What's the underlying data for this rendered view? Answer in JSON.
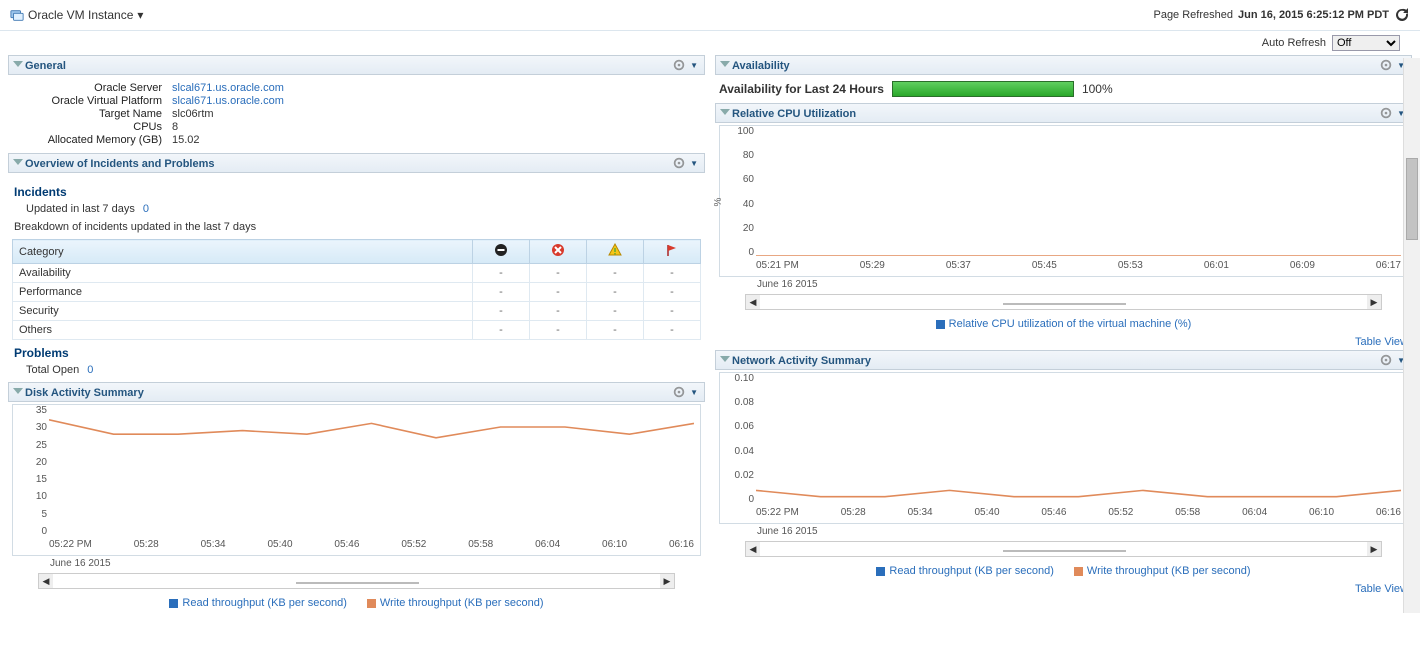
{
  "header": {
    "title": "Oracle VM Instance",
    "refresh_label": "Page Refreshed",
    "refresh_time": "Jun 16, 2015 6:25:12 PM PDT"
  },
  "auto_refresh": {
    "label": "Auto Refresh",
    "selected": "Off",
    "options": [
      "Off"
    ]
  },
  "general": {
    "title": "General",
    "rows": [
      {
        "k": "Oracle Server",
        "v": "slcal671.us.oracle.com",
        "link": true
      },
      {
        "k": "Oracle Virtual Platform",
        "v": "slcal671.us.oracle.com",
        "link": true
      },
      {
        "k": "Target Name",
        "v": "slc06rtm"
      },
      {
        "k": "CPUs",
        "v": "8"
      },
      {
        "k": "Allocated Memory (GB)",
        "v": "15.02"
      }
    ]
  },
  "incidents": {
    "title": "Overview of Incidents and Problems",
    "sub1": "Incidents",
    "updated_lbl": "Updated in last 7 days",
    "updated_val": "0",
    "breakdown_lbl": "Breakdown of incidents updated in the last 7 days",
    "cat_header": "Category",
    "rows": [
      {
        "c": "Availability",
        "v": [
          "-",
          "-",
          "-",
          "-"
        ]
      },
      {
        "c": "Performance",
        "v": [
          "-",
          "-",
          "-",
          "-"
        ]
      },
      {
        "c": "Security",
        "v": [
          "-",
          "-",
          "-",
          "-"
        ]
      },
      {
        "c": "Others",
        "v": [
          "-",
          "-",
          "-",
          "-"
        ]
      }
    ],
    "sub2": "Problems",
    "total_open_lbl": "Total Open",
    "total_open_val": "0"
  },
  "disk": {
    "title": "Disk Activity Summary",
    "date": "June 16 2015",
    "legend": [
      {
        "c": "#2a6ebb",
        "t": "Read throughput (KB per second)"
      },
      {
        "c": "#e08a5a",
        "t": "Write throughput (KB per second)"
      }
    ]
  },
  "availability": {
    "title": "Availability",
    "label": "Availability for Last 24 Hours",
    "pct": "100%"
  },
  "cpu": {
    "title": "Relative CPU Utilization",
    "ylabel": "%",
    "date": "June 16 2015",
    "legend": [
      {
        "c": "#2a6ebb",
        "t": "Relative CPU utilization of the virtual machine (%)"
      }
    ],
    "table_view": "Table View"
  },
  "net": {
    "title": "Network Activity Summary",
    "date": "June 16 2015",
    "legend": [
      {
        "c": "#2a6ebb",
        "t": "Read throughput (KB per second)"
      },
      {
        "c": "#e08a5a",
        "t": "Write throughput (KB per second)"
      }
    ],
    "table_view": "Table View"
  },
  "chart_data": [
    {
      "type": "line",
      "title": "Disk Activity Summary",
      "x": [
        "05:22 PM",
        "05:28",
        "05:34",
        "05:40",
        "05:46",
        "05:52",
        "05:58",
        "06:04",
        "06:10",
        "06:16"
      ],
      "ylim": [
        0,
        35
      ],
      "yticks": [
        0,
        5,
        10,
        15,
        20,
        25,
        30,
        35
      ],
      "series": [
        {
          "name": "Write throughput (KB per second)",
          "values": [
            32,
            28,
            28,
            29,
            28,
            31,
            27,
            30,
            30,
            28,
            31
          ]
        }
      ]
    },
    {
      "type": "line",
      "title": "Relative CPU Utilization",
      "x": [
        "05:21 PM",
        "05:29",
        "05:37",
        "05:45",
        "05:53",
        "06:01",
        "06:09",
        "06:17"
      ],
      "ylim": [
        0,
        100
      ],
      "yticks": [
        0,
        20,
        40,
        60,
        80,
        100
      ],
      "ylabel": "%",
      "series": [
        {
          "name": "Relative CPU utilization of the virtual machine (%)",
          "values": [
            0,
            0,
            0,
            0,
            0,
            0,
            0,
            0
          ]
        }
      ]
    },
    {
      "type": "line",
      "title": "Network Activity Summary",
      "x": [
        "05:22 PM",
        "05:28",
        "05:34",
        "05:40",
        "05:46",
        "05:52",
        "05:58",
        "06:04",
        "06:10",
        "06:16"
      ],
      "ylim": [
        0,
        0.1
      ],
      "yticks": [
        0.0,
        0.02,
        0.04,
        0.06,
        0.08,
        0.1
      ],
      "series": [
        {
          "name": "Write throughput (KB per second)",
          "values": [
            0.01,
            0.005,
            0.005,
            0.01,
            0.005,
            0.005,
            0.01,
            0.005,
            0.005,
            0.005,
            0.01
          ]
        }
      ]
    }
  ]
}
